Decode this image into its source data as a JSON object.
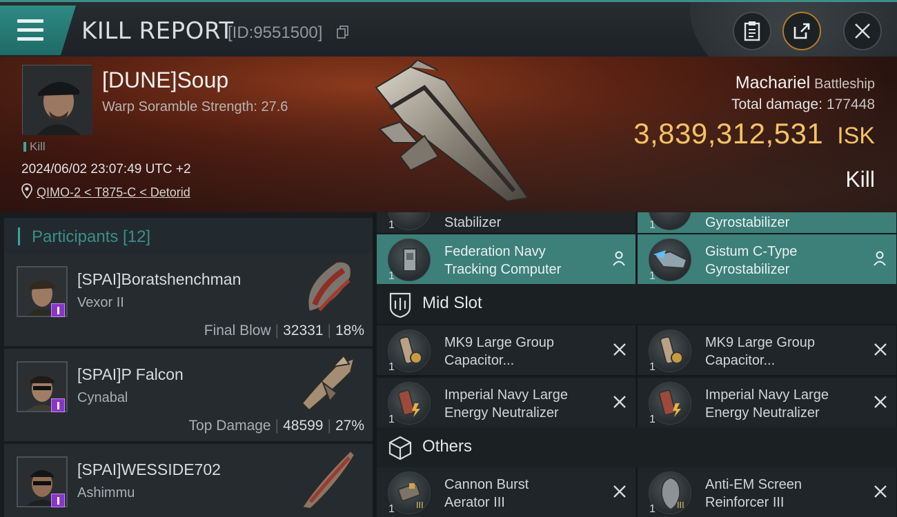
{
  "header": {
    "title": "KILL REPORT",
    "report_id": "[ID:9551500]"
  },
  "victim": {
    "name": "[DUNE]Soup",
    "scramble": "Warp Soramble Strength: 27.6",
    "kill_tag": "Kill",
    "datetime": "2024/06/02 23:07:49 UTC +2",
    "location": "QIMO-2 < T875-C < Detorid",
    "ship_name": "Machariel",
    "ship_class": "Battleship",
    "total_damage_label": "Total damage:",
    "total_damage": "177448",
    "isk_amount": "3,839,312,531",
    "isk_unit": "ISK",
    "outcome": "Kill"
  },
  "participants": {
    "heading": "Participants [12]",
    "items": [
      {
        "name": "[SPAI]Boratshenchman",
        "ship": "Vexor II",
        "stat_label": "Final Blow",
        "damage": "32331",
        "pct": "18%"
      },
      {
        "name": "[SPAI]P Falcon",
        "ship": "Cynabal",
        "stat_label": "Top Damage",
        "damage": "48599",
        "pct": "27%"
      },
      {
        "name": "[SPAI]WESSIDE702",
        "ship": "Ashimmu"
      }
    ]
  },
  "modules": {
    "low_partial": [
      {
        "qty": "1",
        "text": "Stabilizer"
      },
      {
        "qty": "1",
        "text": "Gyrostabilizer"
      }
    ],
    "low": [
      {
        "qty": "1",
        "line1": "Federation Navy",
        "line2": "Tracking Computer"
      },
      {
        "qty": "1",
        "line1": "Gistum C-Type",
        "line2": "Gyrostabilizer"
      }
    ],
    "mid_heading": "Mid Slot",
    "mid": [
      {
        "qty": "1",
        "line1": "MK9 Large Group",
        "line2": "Capacitor..."
      },
      {
        "qty": "1",
        "line1": "MK9 Large Group",
        "line2": "Capacitor..."
      },
      {
        "qty": "1",
        "line1": "Imperial Navy Large",
        "line2": "Energy Neutralizer"
      },
      {
        "qty": "1",
        "line1": "Imperial Navy Large",
        "line2": "Energy Neutralizer"
      }
    ],
    "others_heading": "Others",
    "others": [
      {
        "qty": "1",
        "line1": "Cannon Burst",
        "line2": "Aerator III"
      },
      {
        "qty": "1",
        "line1": "Anti-EM Screen",
        "line2": "Reinforcer III"
      }
    ]
  },
  "colors": {
    "accent_teal": "#3d7f79",
    "isk_gold": "#f3c366"
  }
}
